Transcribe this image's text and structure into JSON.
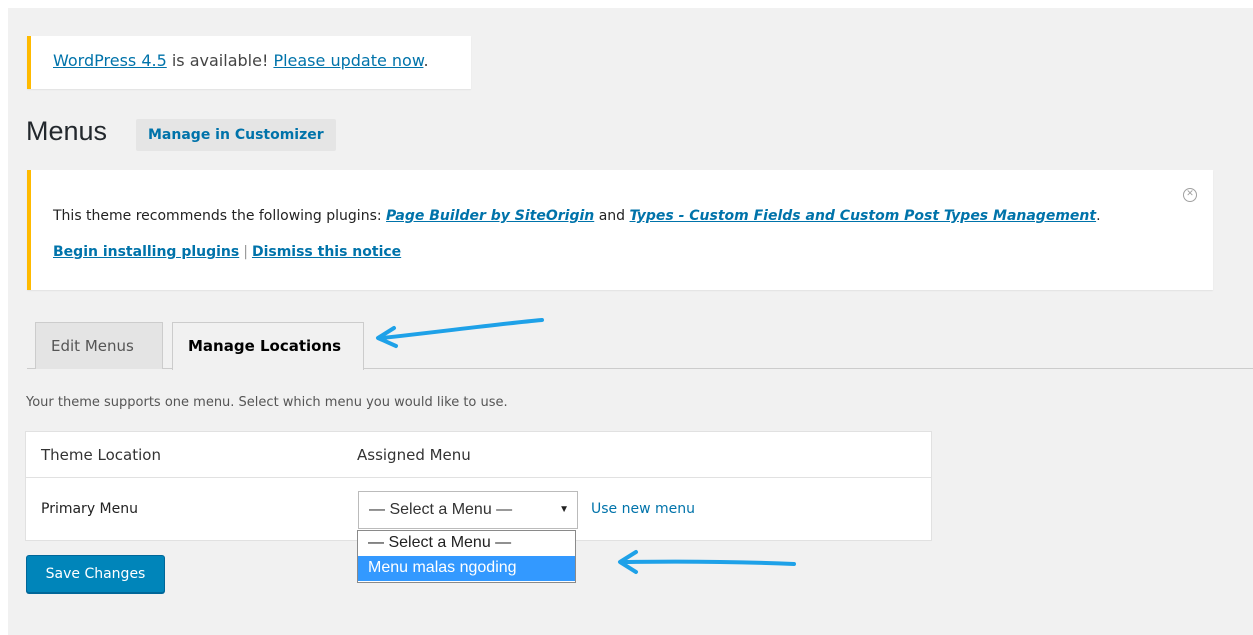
{
  "update_nag": {
    "version_link": "WordPress 4.5",
    "middle_text": " is available! ",
    "update_link": "Please update now",
    "end_text": "."
  },
  "header": {
    "title": "Menus",
    "action": "Manage in Customizer"
  },
  "plugin_notice": {
    "prefix": "This theme recommends the following plugins: ",
    "plugin_1": "Page Builder by SiteOrigin",
    "and_text": " and ",
    "plugin_2": "Types - Custom Fields and Custom Post Types Management",
    "suffix": ".",
    "begin_link": "Begin installing plugins",
    "separator": "|",
    "dismiss_link": "Dismiss this notice"
  },
  "tabs": [
    {
      "label": "Edit Menus",
      "active": false
    },
    {
      "label": "Manage Locations",
      "active": true
    }
  ],
  "helper_text": "Your theme supports one menu. Select which menu you would like to use.",
  "locations_table": {
    "headers": [
      "Theme Location",
      "Assigned Menu"
    ],
    "rows": [
      {
        "location": "Primary Menu",
        "selected": "— Select a Menu —",
        "use_new": "Use new menu"
      }
    ]
  },
  "dropdown": {
    "options": [
      "— Select a Menu —",
      "Menu malas ngoding"
    ],
    "highlighted_index": 1
  },
  "save_button": "Save Changes",
  "colors": {
    "accent": "#0073aa",
    "primary_button": "#0085ba",
    "notice_border": "#ffba00",
    "annotation_arrow": "#1ea1e8",
    "dropdown_highlight": "#3399ff"
  }
}
